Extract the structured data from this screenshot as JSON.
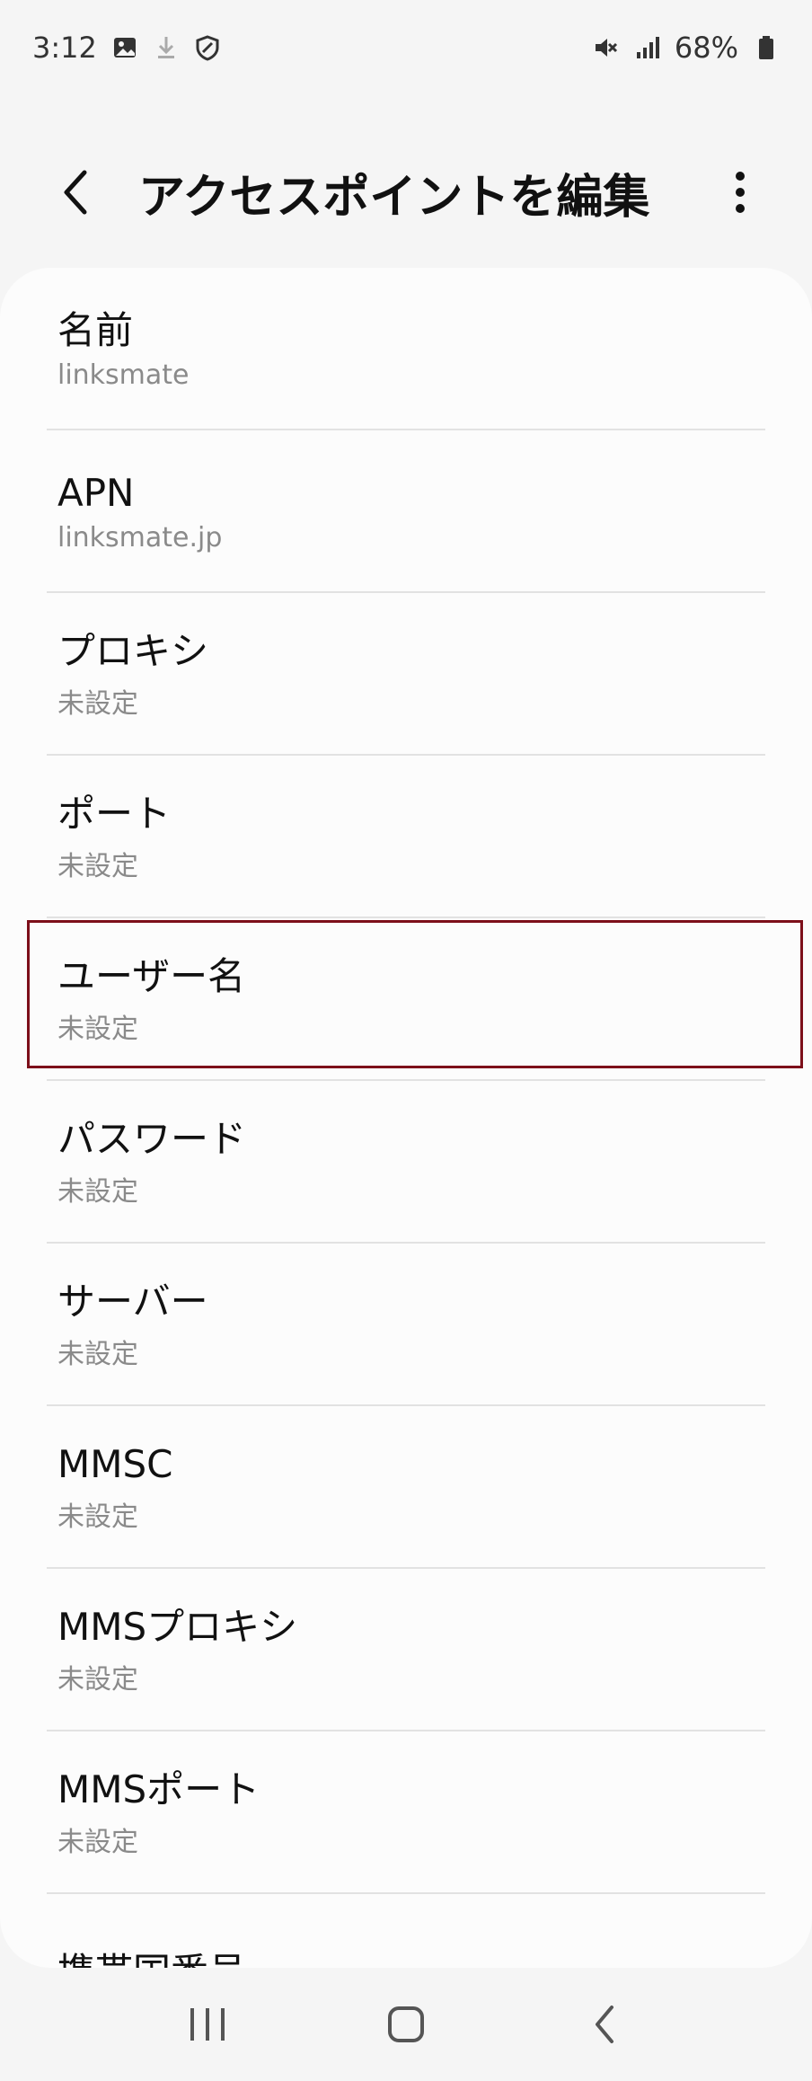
{
  "status_bar": {
    "time": "3:12",
    "battery": "68%",
    "icons": [
      "gallery-icon",
      "download-icon",
      "shield-icon",
      "mute-icon",
      "signal-icon",
      "battery-icon"
    ]
  },
  "header": {
    "title": "アクセスポイントを編集",
    "back_icon": "chevron-left-icon",
    "more_icon": "more-vertical-icon"
  },
  "items": [
    {
      "label": "名前",
      "value": "linksmate"
    },
    {
      "label": "APN",
      "value": "linksmate.jp"
    },
    {
      "label": "プロキシ",
      "value": "未設定"
    },
    {
      "label": "ポート",
      "value": "未設定"
    },
    {
      "label": "ユーザー名",
      "value": "未設定",
      "highlighted": true
    },
    {
      "label": "パスワード",
      "value": "未設定"
    },
    {
      "label": "サーバー",
      "value": "未設定"
    },
    {
      "label": "MMSC",
      "value": "未設定"
    },
    {
      "label": "MMSプロキシ",
      "value": "未設定"
    },
    {
      "label": "MMSポート",
      "value": "未設定"
    },
    {
      "label": "携帯国番号",
      "value": ""
    }
  ],
  "colors": {
    "highlight_border": "#7d0f1a",
    "card_background": "#fcfcfc",
    "secondary_text": "#8a8a8a"
  },
  "nav_bar": {
    "icons": [
      "recent-apps-icon",
      "home-icon",
      "back-icon"
    ]
  }
}
